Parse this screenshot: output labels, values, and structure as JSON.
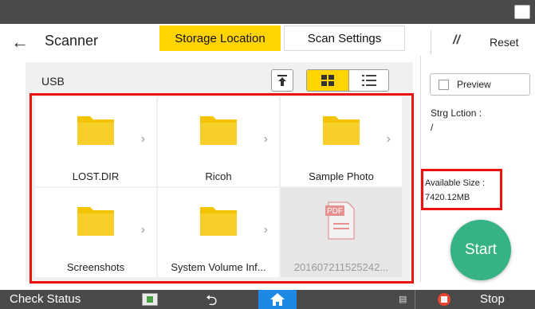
{
  "header": {
    "title": "Scanner",
    "tab_storage": "Storage Location",
    "tab_scan": "Scan Settings",
    "reset": "Reset"
  },
  "location": {
    "label": "USB"
  },
  "files": [
    {
      "name": "LOST.DIR",
      "type": "folder"
    },
    {
      "name": "Ricoh",
      "type": "folder"
    },
    {
      "name": "Sample Photo",
      "type": "folder"
    },
    {
      "name": "Screenshots",
      "type": "folder"
    },
    {
      "name": "System Volume Inf...",
      "type": "folder"
    },
    {
      "name": "201607211525242...",
      "type": "pdf",
      "badge": "PDF",
      "disabled": true
    }
  ],
  "side": {
    "preview": "Preview",
    "storage_location_label": "Strg Lction :",
    "storage_location_value": "/",
    "available_size_label": "Available Size :",
    "available_size_value": "7420.12MB",
    "start": "Start"
  },
  "footer": {
    "check_status": "Check Status",
    "stop": "Stop"
  },
  "colors": {
    "accent_yellow": "#ffd400",
    "start_green": "#36b384",
    "home_blue": "#1e88e5",
    "highlight_red": "#ee1111",
    "folder_yellow": "#f5c400"
  }
}
